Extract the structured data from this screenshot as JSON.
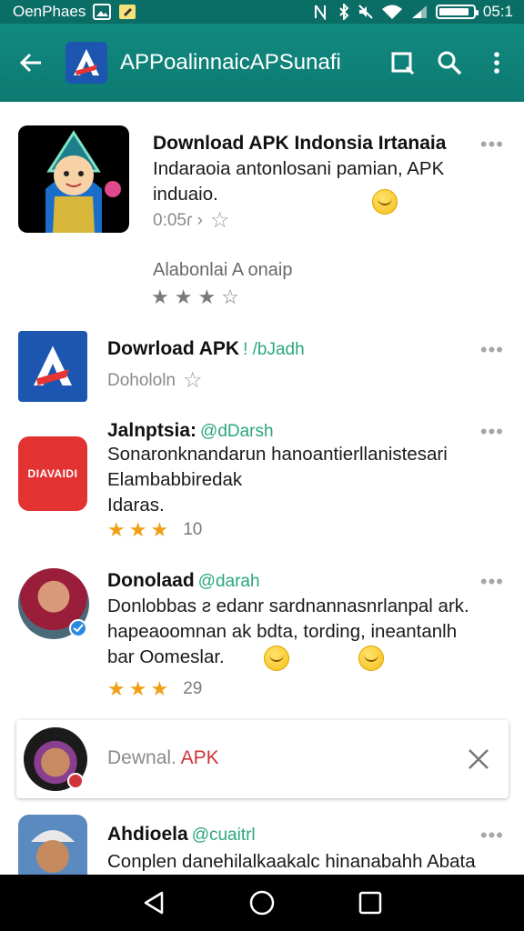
{
  "status_bar": {
    "carrier": "OenPhaes",
    "time": "05:1",
    "battery_level": 0.9
  },
  "app_bar": {
    "title": "APPoalinnaicAPSunafi",
    "back_icon": "arrow-left-icon",
    "actions": [
      "crop-square-icon",
      "search-icon",
      "more-vert-icon"
    ]
  },
  "colors": {
    "primary": "#0d7a71",
    "accent_red": "#d0343a",
    "star": "#f0a017",
    "tag_green": "#2aa77a"
  },
  "items": [
    {
      "title": "Download APK Indonsia Irtanaia",
      "desc": [
        "Indaraoia antonlosani pamian, APK",
        "induaio."
      ],
      "meta": "0:05ɾ ›",
      "sub_label": "Alabonlai A onaip",
      "rating": 3
    },
    {
      "title": "Dowrload APK",
      "tag": "! /bJadh",
      "meta": "Dohololn"
    },
    {
      "title": "Jalnptsia:",
      "tag": "@dDarsh",
      "desc": [
        "Sonaronknandarun hanoantierllanistesari",
        "Elambabbiredak",
        "Idaras."
      ],
      "rating": 3,
      "count": "10",
      "icon_text": "DIAVAIDI"
    },
    {
      "title": "Donolaad",
      "tag": "@darah",
      "desc": [
        "Donlobbas ƨ edanr sardnannasnrlanpal ark.",
        "hapeaoomnan ak bdta, tording, ineantanlh",
        "bar Oomeslar."
      ],
      "rating": 3,
      "count": "29"
    },
    {
      "title": "Ahdioela",
      "tag": "@cuaitrl",
      "desc": [
        "Conplen danehilalkaakalc hinanabahh Abata"
      ]
    }
  ],
  "suggestion": {
    "text": "Dewnal.",
    "accent": "APK"
  },
  "nav": [
    "back-triangle-icon",
    "home-circle-icon",
    "recents-square-icon"
  ]
}
